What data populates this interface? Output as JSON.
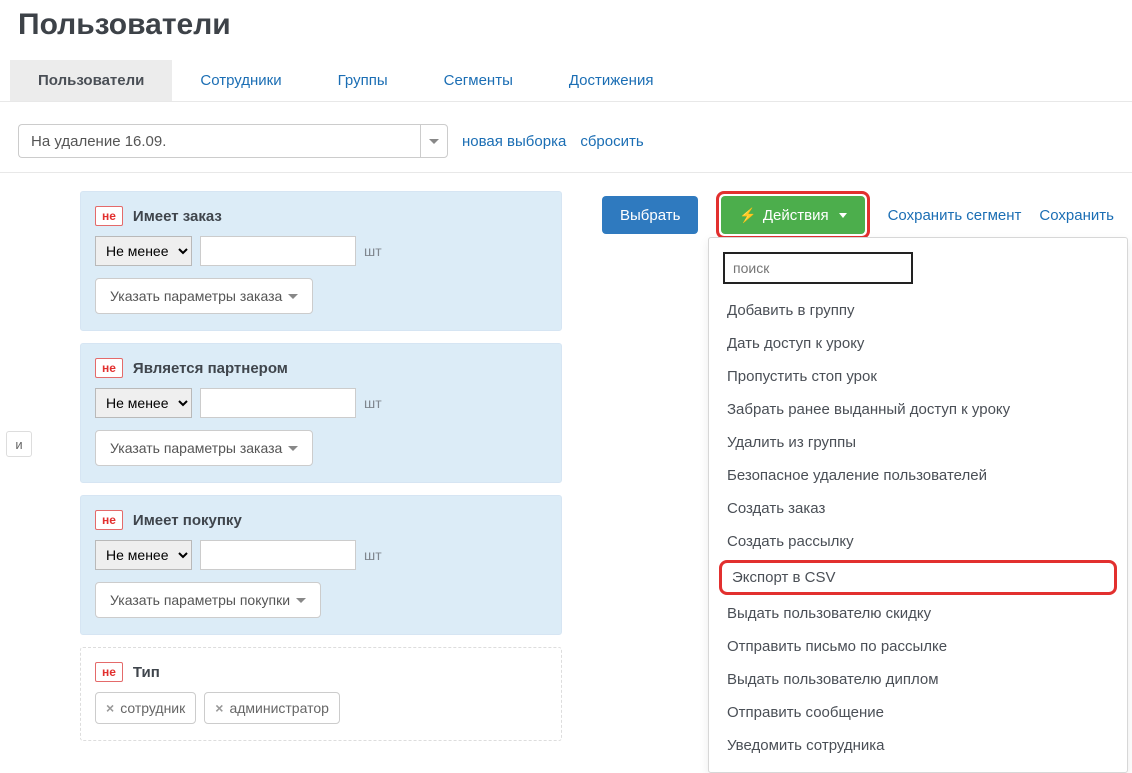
{
  "title": "Пользователи",
  "tabs": [
    "Пользователи",
    "Сотрудники",
    "Группы",
    "Сегменты",
    "Достижения"
  ],
  "toolbar": {
    "selection": "На удаление 16.09.",
    "new": "новая выборка",
    "reset": "сбросить"
  },
  "and_label": "и",
  "filters": [
    {
      "neg": "не",
      "title": "Имеет заказ",
      "op": "Не менее",
      "unit": "шт",
      "btn": "Указать параметры заказа"
    },
    {
      "neg": "не",
      "title": "Является партнером",
      "op": "Не менее",
      "unit": "шт",
      "btn": "Указать параметры заказа"
    },
    {
      "neg": "не",
      "title": "Имеет покупку",
      "op": "Не менее",
      "unit": "шт",
      "btn": "Указать параметры покупки"
    }
  ],
  "type_filter": {
    "neg": "не",
    "title": "Тип",
    "tags": [
      "сотрудник",
      "администратор"
    ]
  },
  "actions": {
    "select": "Выбрать",
    "menu": "Действия",
    "save_segment": "Сохранить сегмент",
    "save_other": "Сохранить "
  },
  "dropdown": {
    "search_placeholder": "поиск",
    "items": [
      "Добавить в группу",
      "Дать доступ к уроку",
      "Пропустить стоп урок",
      "Забрать ранее выданный доступ к уроку",
      "Удалить из группы",
      "Безопасное удаление пользователей",
      "Создать заказ",
      "Создать рассылку",
      "Экспорт в CSV",
      "Выдать пользователю скидку",
      "Отправить письмо по рассылке",
      "Выдать пользователю диплом",
      "Отправить сообщение",
      "Уведомить сотрудника"
    ]
  }
}
